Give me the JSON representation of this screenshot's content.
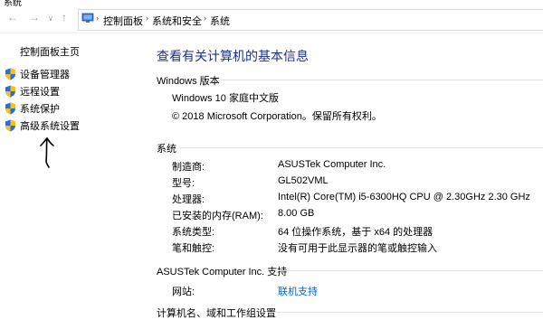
{
  "window": {
    "title": "系统"
  },
  "nav": {
    "back": "←",
    "forward": "→",
    "dropdown": "∨",
    "up": "↑"
  },
  "breadcrumb": [
    "控制面板",
    "系统和安全",
    "系统"
  ],
  "sidebar": {
    "home": "控制面板主页",
    "items": [
      {
        "label": "设备管理器",
        "icon": "shield-icon"
      },
      {
        "label": "远程设置",
        "icon": "shield-icon"
      },
      {
        "label": "系统保护",
        "icon": "shield-icon"
      },
      {
        "label": "高级系统设置",
        "icon": "shield-icon"
      }
    ]
  },
  "main": {
    "title": "查看有关计算机的基本信息",
    "windows_edition": {
      "header": "Windows 版本",
      "edition": "Windows 10 家庭中文版",
      "copyright": "© 2018 Microsoft Corporation。保留所有权利。"
    },
    "system": {
      "header": "系统",
      "rows": [
        {
          "label": "制造商:",
          "value": "ASUSTek Computer Inc."
        },
        {
          "label": "型号:",
          "value": "GL502VML"
        },
        {
          "label": "处理器:",
          "value": "Intel(R) Core(TM) i5-6300HQ CPU @ 2.30GHz   2.30 GHz"
        },
        {
          "label": "已安装的内存(RAM):",
          "value": "8.00 GB"
        },
        {
          "label": "系统类型:",
          "value": "64 位操作系统，基于 x64 的处理器"
        },
        {
          "label": "笔和触控:",
          "value": "没有可用于此显示器的笔或触控输入"
        }
      ]
    },
    "support": {
      "header": "ASUSTek Computer Inc. 支持",
      "website_label": "网站:",
      "website_link": "联机支持"
    },
    "computer_name": {
      "header": "计算机名、域和工作组设置"
    }
  },
  "colors": {
    "title": "#1e3287",
    "link": "#0b63c4"
  }
}
